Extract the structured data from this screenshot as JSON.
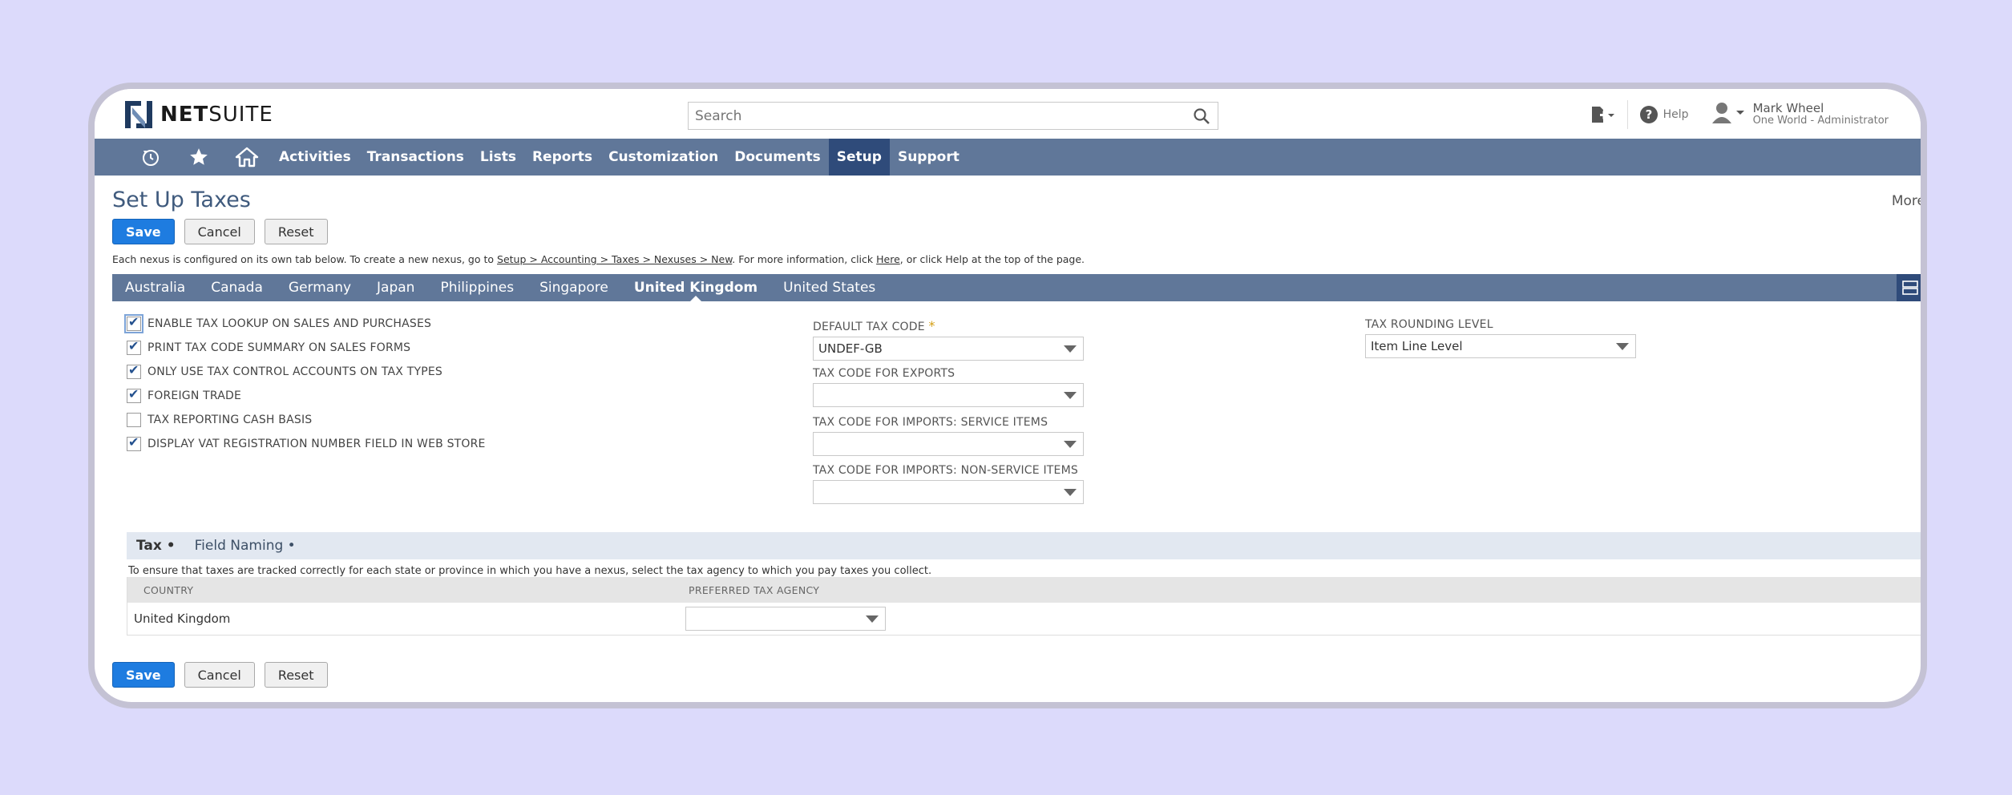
{
  "header": {
    "logo_text_bold": "NET",
    "logo_text_light": "SUITE",
    "search_placeholder": "Search",
    "help_label": "Help",
    "user_name": "Mark Wheel",
    "user_role": "One World - Administrator"
  },
  "nav": {
    "items": [
      "Activities",
      "Transactions",
      "Lists",
      "Reports",
      "Customization",
      "Documents",
      "Setup",
      "Support"
    ],
    "active": "Setup"
  },
  "page": {
    "title": "Set Up Taxes",
    "more_label": "More",
    "info_prefix": "Each nexus is configured on its own tab below. To create a new nexus, go to ",
    "info_link": "Setup > Accounting > Taxes > Nexuses > New",
    "info_mid": ". For more information, click ",
    "info_here": "Here",
    "info_suffix": ", or click Help at the top of the page."
  },
  "buttons": {
    "save": "Save",
    "cancel": "Cancel",
    "reset": "Reset"
  },
  "tabs": [
    "Australia",
    "Canada",
    "Germany",
    "Japan",
    "Philippines",
    "Singapore",
    "United Kingdom",
    "United States"
  ],
  "active_tab": "United Kingdom",
  "checkboxes": [
    {
      "label": "ENABLE TAX LOOKUP ON SALES AND PURCHASES",
      "checked": true
    },
    {
      "label": "PRINT TAX CODE SUMMARY ON SALES FORMS",
      "checked": true
    },
    {
      "label": "ONLY USE TAX CONTROL ACCOUNTS ON TAX TYPES",
      "checked": true
    },
    {
      "label": "FOREIGN TRADE",
      "checked": true
    },
    {
      "label": "TAX REPORTING CASH BASIS",
      "checked": false
    },
    {
      "label": "DISPLAY VAT REGISTRATION NUMBER FIELD IN WEB STORE",
      "checked": true
    }
  ],
  "fields": {
    "default_tax_code": {
      "label": "DEFAULT TAX CODE",
      "required_mark": "*",
      "value": "UNDEF-GB"
    },
    "tax_code_exports": {
      "label": "TAX CODE FOR EXPORTS",
      "value": ""
    },
    "tax_code_imports_service": {
      "label": "TAX CODE FOR IMPORTS: SERVICE ITEMS",
      "value": ""
    },
    "tax_code_imports_nonservice": {
      "label": "TAX CODE FOR IMPORTS: NON-SERVICE ITEMS",
      "value": ""
    },
    "tax_rounding_level": {
      "label": "TAX ROUNDING LEVEL",
      "value": "Item Line Level"
    }
  },
  "subtabs": [
    "Tax •",
    "Field Naming •"
  ],
  "subtab_note": "To ensure that taxes are tracked correctly for each state or province in which you have a nexus, select the tax agency to which you pay taxes you collect.",
  "table": {
    "headers": [
      "COUNTRY",
      "PREFERRED TAX AGENCY"
    ],
    "rows": [
      {
        "country": "United Kingdom",
        "agency": ""
      }
    ]
  },
  "colors": {
    "nav": "#607799",
    "nav_active": "#2f4b7a",
    "primary_button": "#1e7ce0",
    "title": "#3f5a7d"
  }
}
